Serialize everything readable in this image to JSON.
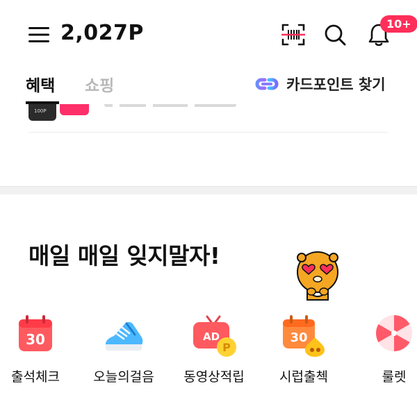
{
  "header": {
    "points": "2,027P",
    "notification_badge": "10+",
    "icons": [
      "menu-icon",
      "barcode-scan-icon",
      "search-icon",
      "bell-icon"
    ]
  },
  "tabs": [
    {
      "label": "혜택",
      "active": true
    },
    {
      "label": "쇼핑",
      "active": false
    }
  ],
  "card_points_link": {
    "label": "카드포인트 찾기",
    "icon": "link-icon"
  },
  "clipped_item": {
    "thumb_text": "100P"
  },
  "daily_section": {
    "title": "매일 매일 잊지말자!",
    "features": [
      {
        "label": "출석체크",
        "icon": "calendar-30-icon"
      },
      {
        "label": "오늘의걸음",
        "icon": "sneaker-icon"
      },
      {
        "label": "동영상적립",
        "icon": "ad-tv-icon"
      },
      {
        "label": "시럽출첵",
        "icon": "calendar-30-syrup-icon"
      },
      {
        "label": "룰렛",
        "icon": "roulette-icon"
      }
    ]
  },
  "colors": {
    "accent_pink": "#ff2f5a",
    "calendar_red": "#ff5a5f",
    "inactive_tab": "#b9b9b9"
  }
}
